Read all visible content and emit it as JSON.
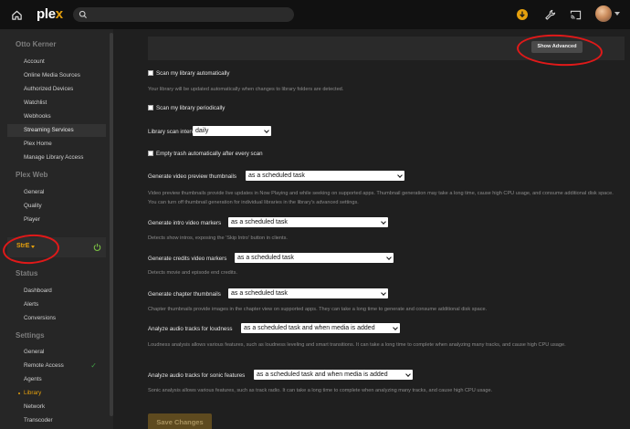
{
  "topbar": {
    "logo_prefix": "ple",
    "logo_x": "x",
    "icons": [
      "home-icon",
      "search-icon",
      "activity-icon",
      "wrench-icon",
      "cast-icon",
      "avatar"
    ],
    "accent": "#e5a00d"
  },
  "sidebar": {
    "account_heading": "Otto Kerner",
    "account_items": [
      "Account",
      "Online Media Sources",
      "Authorized Devices",
      "Watchlist",
      "Webhooks",
      "Streaming Services",
      "Plex Home",
      "Manage Library Access"
    ],
    "plexweb_heading": "Plex Web",
    "plexweb_items": [
      "General",
      "Quality",
      "Player"
    ],
    "server_name": "StrE",
    "status_heading": "Status",
    "status_items": [
      "Dashboard",
      "Alerts",
      "Conversions"
    ],
    "settings_heading": "Settings",
    "settings_items": [
      "General",
      "Remote Access",
      "Agents",
      "Library",
      "Network",
      "Transcoder"
    ],
    "remote_access_check": "✓"
  },
  "main": {
    "show_advanced_label": "Show Advanced",
    "scan_auto_label": "Scan my library automatically",
    "scan_auto_help": "Your library will be updated automatically when changes to library folders are detected.",
    "scan_periodic_label": "Scan my library periodically",
    "scan_interval_label": "Library scan interval",
    "scan_interval_value": "daily",
    "empty_trash_label": "Empty trash automatically after every scan",
    "video_preview_label": "Generate video preview thumbnails",
    "video_preview_value": "as a scheduled task",
    "video_preview_help": "Video preview thumbnails provide live updates in Now Playing and while seeking on supported apps. Thumbnail generation may take a long time, cause high CPU usage, and consume additional disk space. You can turn off thumbnail generation for individual libraries in the library's advanced settings.",
    "intro_label": "Generate intro video markers",
    "intro_value": "as a scheduled task",
    "intro_help": "Detects show intros, exposing the 'Skip Intro' button in clients.",
    "credits_label": "Generate credits video markers",
    "credits_value": "as a scheduled task",
    "credits_help": "Detects movie and episode end credits.",
    "chapter_label": "Generate chapter thumbnails",
    "chapter_value": "as a scheduled task",
    "chapter_help": "Chapter thumbnails provide images in the chapter view on supported apps. They can take a long time to generate and consume additional disk space.",
    "loudness_label": "Analyze audio tracks for loudness",
    "loudness_value": "as a scheduled task and when media is added",
    "loudness_help": "Loudness analysis allows various features, such as loudness leveling and smart transitions. It can take a long time to complete when analyzing many tracks, and cause high CPU usage.",
    "sonic_label": "Analyze audio tracks for sonic features",
    "sonic_value": "as a scheduled task and when media is added",
    "sonic_help": "Sonic analysis allows various features, such as track radio. It can take a long time to complete when analyzing many tracks, and cause high CPU usage.",
    "save_label": "Save Changes"
  }
}
